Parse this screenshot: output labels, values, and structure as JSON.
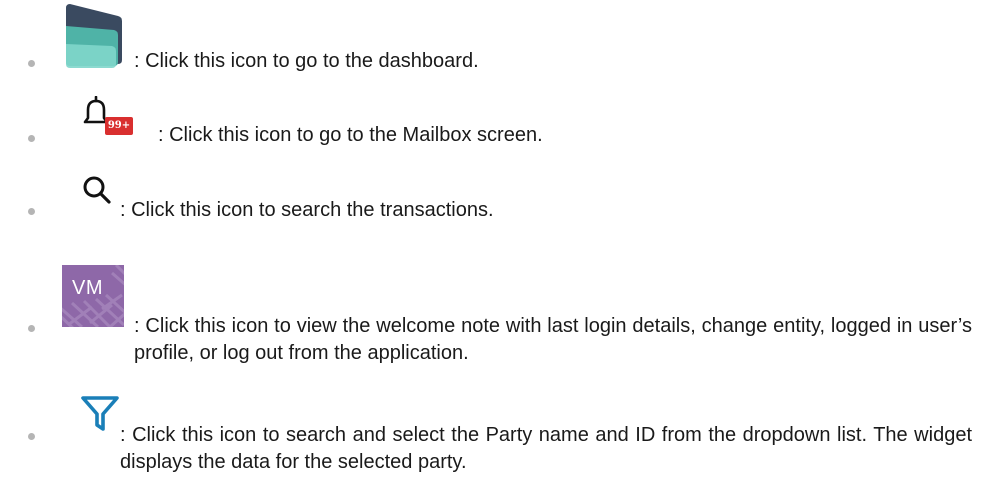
{
  "items": [
    {
      "icon": "dashboard-logo-icon",
      "description": ": Click this icon to go to the dashboard."
    },
    {
      "icon": "bell-icon",
      "badge": "99+",
      "description": ": Click this icon to go to the Mailbox screen."
    },
    {
      "icon": "search-icon",
      "description": ": Click this icon to search the transactions."
    },
    {
      "icon": "user-avatar-icon",
      "avatar_initials": "VM",
      "description": ": Click this icon to view the welcome note with last login details, change entity, logged in user’s profile, or log out from the application."
    },
    {
      "icon": "filter-icon",
      "description": ": Click this icon to search and select the Party name and ID from the dropdown list. The widget displays the data for the selected party."
    }
  ],
  "colors": {
    "dashboard_dark": "#3a4a60",
    "dashboard_teal": "#5ec4b8",
    "badge_red": "#d92f2f",
    "avatar_purple": "#8e68a8",
    "filter_blue": "#1a7fb8",
    "bullet_gray": "#b5b5b5"
  }
}
